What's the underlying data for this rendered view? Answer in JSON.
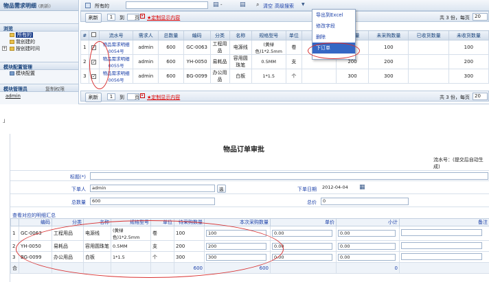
{
  "sidebar": {
    "title": "物品需求明细",
    "title_sub": "(刷新)",
    "section_browse": "浏览",
    "items": [
      {
        "label": "所有的",
        "selected": true
      },
      {
        "label": "我创建的",
        "selected": false
      },
      {
        "label": "按创建时间",
        "selected": false
      }
    ],
    "section_config": "模块配置管理",
    "config_item": "模块配置",
    "section_admin": "模块管理员",
    "admin_action": "复制权限",
    "admin_user": "admin"
  },
  "toolbar": {
    "scope_label": "所有的",
    "clear": "清空",
    "advanced_search": "高级搜索",
    "dropdown_arrow": "▼"
  },
  "pager_top": {
    "refresh": "刷新",
    "page": "1",
    "goto": "到",
    "page_unit": "页",
    "custom_fields": "★定制显示内容",
    "total": "共 3 份，每页",
    "per_page": "20"
  },
  "menu": {
    "items": [
      "导出到Excel",
      "修改字段",
      "删除",
      "下订单"
    ],
    "highlighted": "下订单"
  },
  "grid": {
    "columns": [
      "#",
      "",
      "流水号",
      "需求人",
      "总数量",
      "编码",
      "分类",
      "名称",
      "规格型号",
      "单位",
      "",
      "购数量",
      "未采购数量",
      "已收货数量",
      "未收货数量"
    ],
    "rows": [
      {
        "no": "1",
        "serial": "物品需求明细0054号",
        "requester": "admin",
        "total": "600",
        "code": "GC-0063",
        "category": "工程用品",
        "name": "电源线",
        "spec": "(黄绿色)1*2.5mm",
        "unit": "卷",
        "purchased": "",
        "unpurchased": "100",
        "received": "",
        "unreceived": "100"
      },
      {
        "no": "2",
        "serial": "物品需求明细0055号",
        "requester": "admin",
        "total": "600",
        "code": "YH-0050",
        "category": "易耗品",
        "name": "容用圆珠笔",
        "spec": "0.5MM",
        "unit": "支",
        "purchased": "200",
        "unpurchased": "200",
        "received": "",
        "unreceived": "200"
      },
      {
        "no": "3",
        "serial": "物品需求明细0056号",
        "requester": "admin",
        "total": "600",
        "code": "BG-0099",
        "category": "办公用品",
        "name": "白板",
        "spec": "1*1.5",
        "unit": "个",
        "purchased": "300",
        "unpurchased": "300",
        "received": "",
        "unreceived": "300"
      }
    ]
  },
  "pager_bottom": {
    "refresh": "刷新",
    "page": "1",
    "goto": "到",
    "page_unit": "页",
    "custom_fields": "★定制显示内容",
    "total": "共 3 份，每页",
    "per_page": "20"
  },
  "separator_mark": "」",
  "form": {
    "title": "物品订单审批",
    "serial_label": "流水号：",
    "serial_value": "(提交后自动生成)",
    "title_label": "标题(*)",
    "title_value": "",
    "orderer_label": "下单人",
    "orderer_value": "admin",
    "select_btn": "选",
    "order_date_label": "下单日期",
    "order_date_value": "2012-04-04",
    "total_qty_label": "总数量",
    "total_qty_value": "600",
    "total_price_label": "总价",
    "total_price_value": "0",
    "detail_section": "查看对应的明细汇总"
  },
  "detail": {
    "columns": [
      "",
      "编码",
      "分类",
      "名称",
      "规格型号",
      "单位",
      "待采购数量",
      "本次采购数量",
      "单价",
      "小计",
      "备注"
    ],
    "rows": [
      {
        "no": "1",
        "code": "GC-0063",
        "category": "工程用品",
        "name": "电源线",
        "spec": "(黄绿色)1*2.5mm",
        "unit": "卷",
        "pending": "100",
        "qty": "100",
        "price": "0.00",
        "subtotal": "0.00",
        "remark": ""
      },
      {
        "no": "2",
        "code": "YH-0050",
        "category": "易耗品",
        "name": "容用圆珠笔",
        "spec": "0.5MM",
        "unit": "支",
        "pending": "200",
        "qty": "200",
        "price": "0.00",
        "subtotal": "0.00",
        "remark": ""
      },
      {
        "no": "3",
        "code": "BG-0099",
        "category": "办公用品",
        "name": "白板",
        "spec": "1*1.5",
        "unit": "个",
        "pending": "300",
        "qty": "300",
        "price": "0.00",
        "subtotal": "0.00",
        "remark": ""
      }
    ],
    "footer_label": "合",
    "footer_pending": "600",
    "footer_qty": "600",
    "footer_subtotal": "0"
  }
}
